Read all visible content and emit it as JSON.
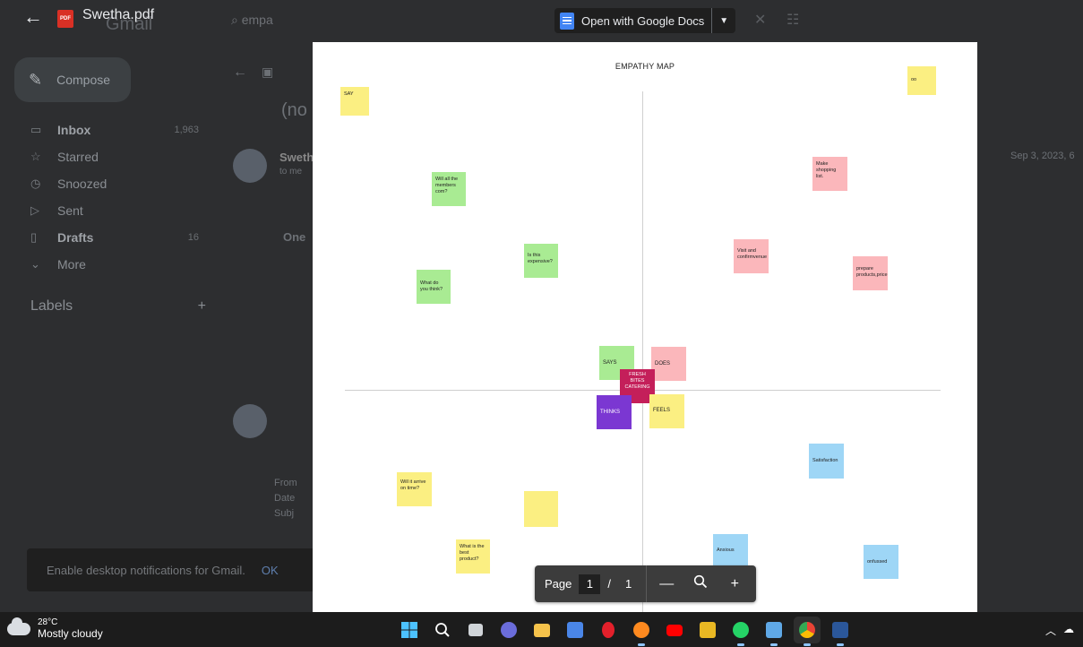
{
  "viewer": {
    "file_name": "Swetha.pdf",
    "pdf_badge": "PDF",
    "open_with_label": "Open with Google Docs"
  },
  "gmail_background": {
    "logo_text": "Gmail",
    "search_text": "empa",
    "compose_label": "Compose",
    "nav": [
      {
        "label": "Inbox",
        "count": "1,963",
        "bold": true,
        "icon": "inbox-icon"
      },
      {
        "label": "Starred",
        "count": "",
        "bold": false,
        "icon": "star-icon"
      },
      {
        "label": "Snoozed",
        "count": "",
        "bold": false,
        "icon": "clock-icon"
      },
      {
        "label": "Sent",
        "count": "",
        "bold": false,
        "icon": "send-icon"
      },
      {
        "label": "Drafts",
        "count": "16",
        "bold": true,
        "icon": "draft-icon"
      },
      {
        "label": "More",
        "count": "",
        "bold": false,
        "icon": "chevron-down-icon"
      }
    ],
    "labels_heading": "Labels",
    "labels_add": "+",
    "subject_partial": "(no",
    "sender_partial": "Sweth",
    "to_partial": "to me",
    "date_partial": "Sep 3, 2023, 6",
    "one_partial": "One",
    "from_partial": "From",
    "date_label_partial": "Date",
    "subj_label_partial": "Subj",
    "notification_text": "Enable desktop notifications for Gmail.",
    "notification_ok": "OK"
  },
  "document": {
    "title": "EMPATHY MAP",
    "notes": [
      {
        "text": "SAY",
        "color": "yellow"
      },
      {
        "text": "oo",
        "color": "yellow"
      },
      {
        "text": "Will all the members com?",
        "color": "green"
      },
      {
        "text": "Make shopping list.",
        "color": "pink"
      },
      {
        "text": "Is this expensive?",
        "color": "green"
      },
      {
        "text": "Visit and confirmvenue",
        "color": "pink"
      },
      {
        "text": "prepare products,price",
        "color": "pink"
      },
      {
        "text": "What do you think?",
        "color": "green"
      },
      {
        "text": "SAYS",
        "color": "green"
      },
      {
        "text": "DOES",
        "color": "pink"
      },
      {
        "text": "FRESH BITES CATERING",
        "color": "magenta"
      },
      {
        "text": "THINKS",
        "color": "purple"
      },
      {
        "text": "FEELS",
        "color": "yellow"
      },
      {
        "text": "Satisfaction",
        "color": "blue"
      },
      {
        "text": "Will it arrive on time?",
        "color": "yellow"
      },
      {
        "text": "",
        "color": "yellow"
      },
      {
        "text": "What is the best product?",
        "color": "yellow"
      },
      {
        "text": "Anxious",
        "color": "blue"
      },
      {
        "text": "onfussed",
        "color": "blue"
      }
    ]
  },
  "page_controls": {
    "page_label": "Page",
    "current_page": "1",
    "separator": "/",
    "total_pages": "1",
    "zoom_out": "—",
    "zoom_in": "+"
  },
  "taskbar": {
    "temperature": "28°C",
    "condition": "Mostly cloudy",
    "apps": [
      "windows-start-icon",
      "search-icon",
      "task-view-icon",
      "teams-icon",
      "file-explorer-icon",
      "store-icon",
      "opera-icon",
      "firefox-icon",
      "youtube-icon",
      "app-icon",
      "whatsapp-icon",
      "photos-icon",
      "chrome-icon",
      "word-icon"
    ]
  }
}
